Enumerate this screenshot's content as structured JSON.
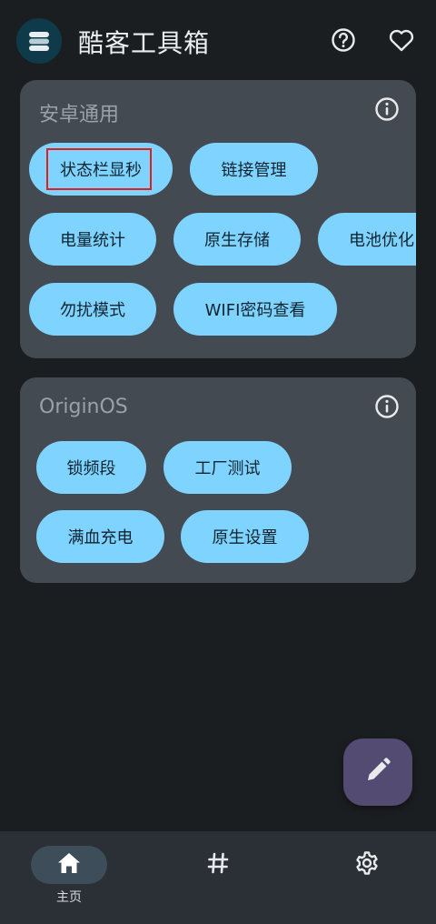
{
  "app": {
    "title": "酷客工具箱",
    "icons": {
      "logo": "stack-logo-icon",
      "help": "help-icon",
      "favorite": "heart-icon"
    }
  },
  "sections": [
    {
      "title": "安卓通用",
      "info_icon": "info-icon",
      "items": [
        "状态栏显秒",
        "链接管理",
        "电量统计",
        "原生存储",
        "电池优化",
        "勿扰模式",
        "WIFI密码查看"
      ]
    },
    {
      "title": "OriginOS",
      "info_icon": "info-icon",
      "items": [
        "锁频段",
        "工厂测试",
        "满血充电",
        "原生设置"
      ]
    }
  ],
  "fab": {
    "icon": "pencil-icon"
  },
  "bottom_nav": {
    "items": [
      {
        "label": "主页",
        "icon": "home-icon",
        "active": true
      },
      {
        "label": "",
        "icon": "hash-icon",
        "active": false
      },
      {
        "label": "",
        "icon": "gear-icon",
        "active": false
      }
    ]
  },
  "colors": {
    "background": "#1b1e21",
    "card": "#444a51",
    "chip": "#7fd3ff",
    "chip_text": "#0f2430",
    "fab": "#534b72",
    "nav_bar": "#2b3036",
    "highlight": "#e0201c"
  }
}
